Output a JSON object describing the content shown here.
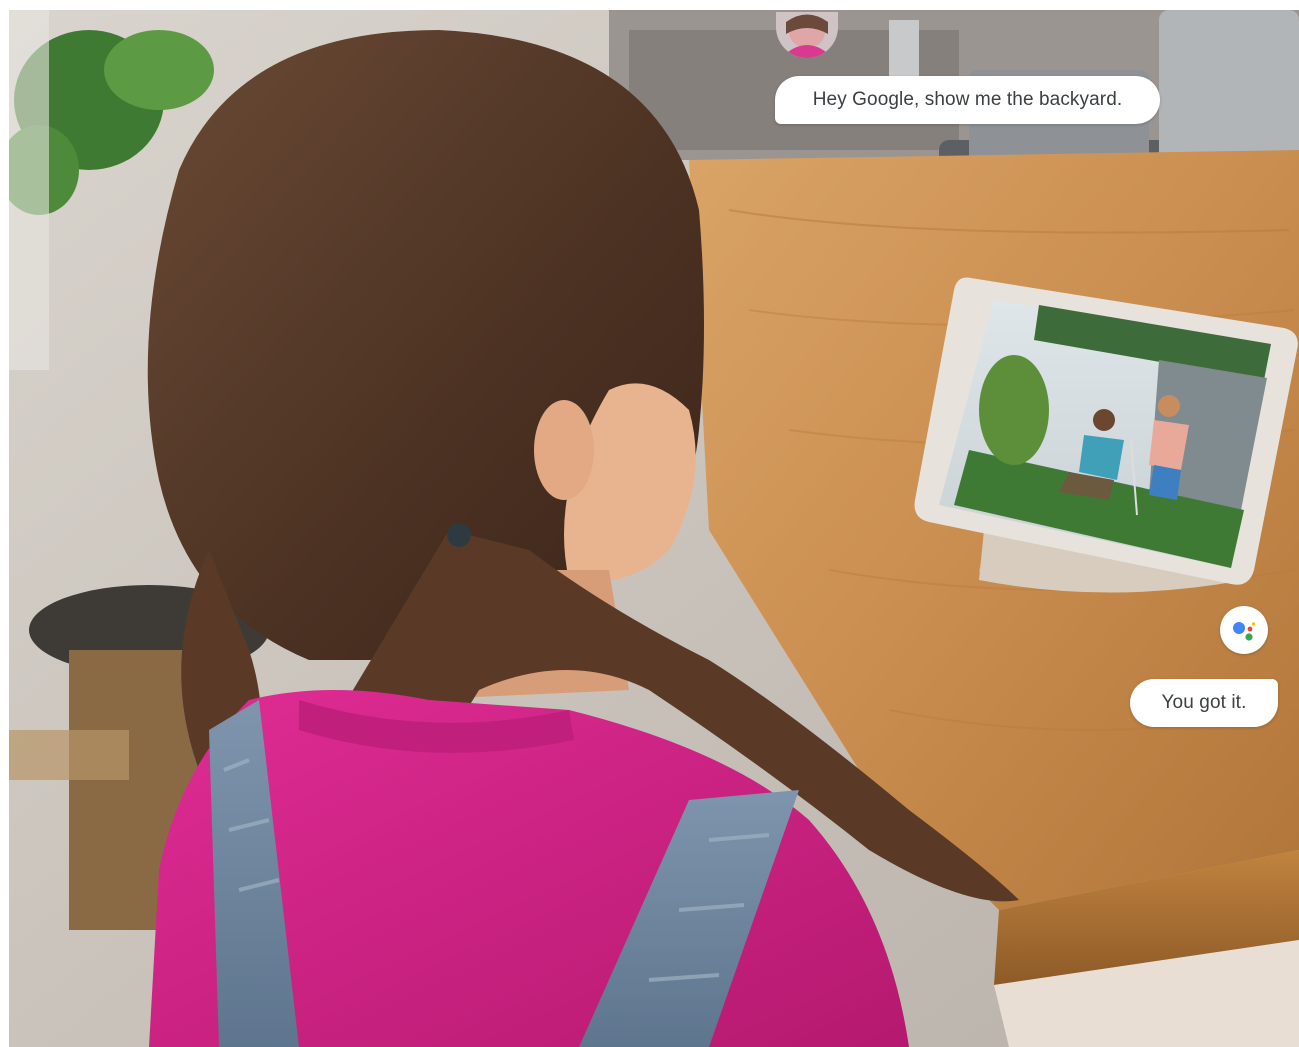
{
  "conversation": {
    "user_message": "Hey Google, show me the backyard.",
    "assistant_reply": "You got it."
  },
  "icons": {
    "user_avatar": "user-avatar",
    "assistant_icon": "google-assistant-icon"
  },
  "colors": {
    "bubble_background": "#ffffff",
    "bubble_text": "#3c4043",
    "assistant_blue": "#4285f4",
    "assistant_red": "#ea4335",
    "assistant_yellow": "#fbbc05",
    "assistant_green": "#34a853"
  }
}
